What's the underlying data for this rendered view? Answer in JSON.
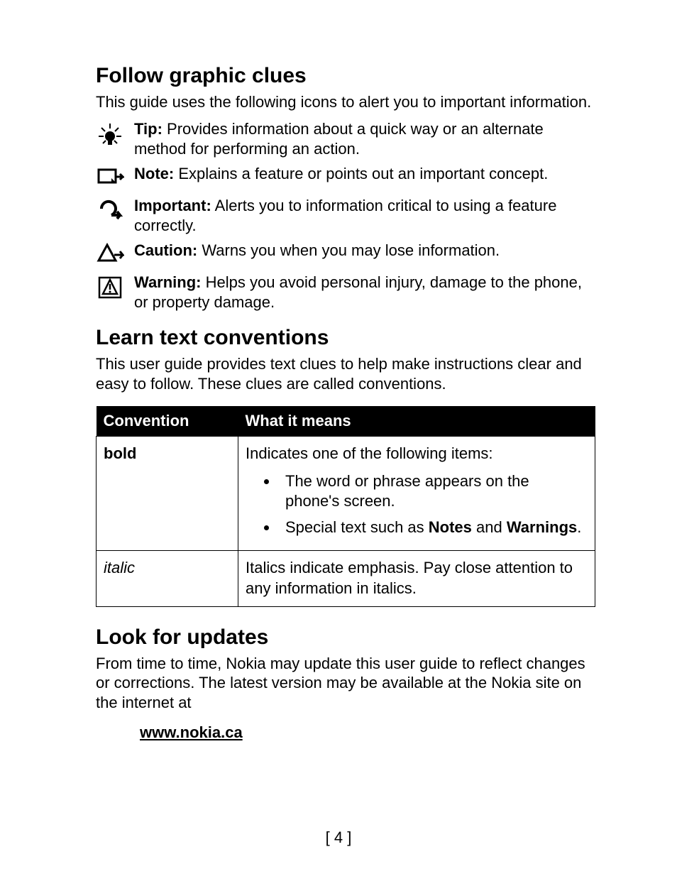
{
  "section1": {
    "heading": "Follow graphic clues",
    "intro": "This guide uses the following icons to alert you to important information.",
    "clues": [
      {
        "label": "Tip:",
        "text": "  Provides information about a quick way or an alternate method for performing an action."
      },
      {
        "label": "Note:",
        "text": " Explains a feature or points out an important concept."
      },
      {
        "label": "Important:",
        "text": "  Alerts you to information critical to using a feature correctly."
      },
      {
        "label": "Caution:",
        "text": "  Warns you when you may lose information."
      },
      {
        "label": "Warning:",
        "text": "  Helps you avoid personal injury, damage to the phone, or property damage."
      }
    ]
  },
  "section2": {
    "heading": "Learn text conventions",
    "intro": "This user guide provides text clues to help make instructions clear and easy to follow. These clues are called conventions.",
    "table": {
      "header": {
        "col1": "Convention",
        "col2": "What it means"
      },
      "rows": [
        {
          "label": "bold",
          "lead": "Indicates one of the following items:",
          "bullets": [
            {
              "pre": "The word or phrase appears on the phone's screen."
            },
            {
              "pre": "Special text such as ",
              "b1": "Notes",
              "mid": " and ",
              "b2": "Warnings",
              "post": "."
            }
          ]
        },
        {
          "label": "italic",
          "text": "Italics indicate emphasis. Pay close attention to any information in italics."
        }
      ]
    }
  },
  "section3": {
    "heading": "Look for updates",
    "intro": "From time to time, Nokia may update this user guide to reflect changes or corrections. The latest version may be available at the Nokia site on the internet at",
    "link": "www.nokia.ca"
  },
  "page_number": "[ 4 ]"
}
